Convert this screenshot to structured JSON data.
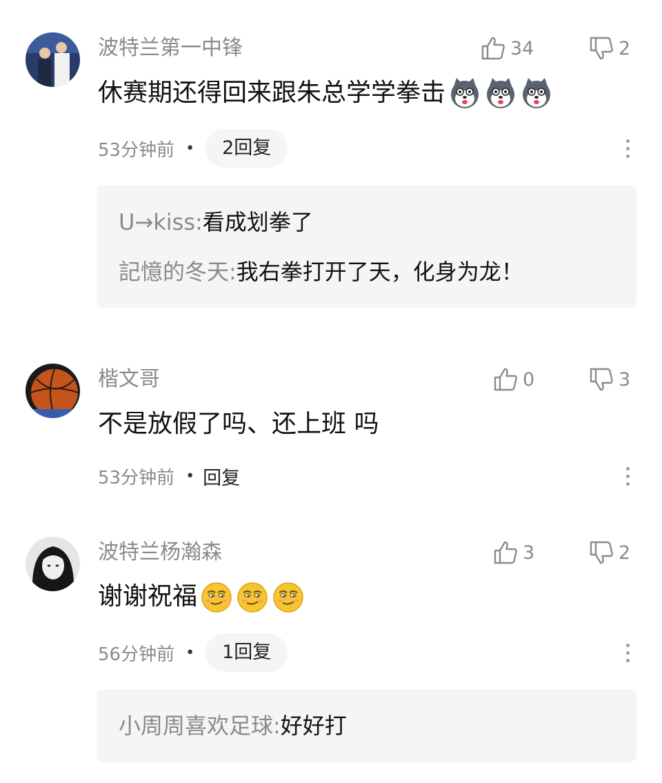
{
  "comments": [
    {
      "username": "波特兰第一中锋",
      "likes": "34",
      "dislikes": "2",
      "text": "休赛期还得回来跟朱总学学拳击",
      "emoji_icon": "husky-emoji",
      "emoji_count": 3,
      "time": "53分钟前",
      "reply_label": "2回复",
      "replies": [
        {
          "user": "U→kiss",
          "sep": ":",
          "text": "看成划拳了"
        },
        {
          "user": "記憶的冬天",
          "sep": ":",
          "text": "我右拳打开了天，化身为龙！"
        }
      ]
    },
    {
      "username": "楷文哥",
      "likes": "0",
      "dislikes": "3",
      "text": "不是放假了吗、还上班 吗",
      "time": "53分钟前",
      "reply_label": "回复",
      "replies": []
    },
    {
      "username": "波特兰杨瀚森",
      "likes": "3",
      "dislikes": "2",
      "text": "谢谢祝福",
      "emoji_icon": "smirk-emoji",
      "emoji_count": 3,
      "time": "56分钟前",
      "reply_label": "1回复",
      "replies": [
        {
          "user": "小周周喜欢足球",
          "sep": ":",
          "text": "好好打"
        }
      ]
    }
  ],
  "separator_dot": "•",
  "colors": {
    "secondary_text": "#8a8a8a",
    "primary_text": "#111111",
    "reply_bg": "#f5f5f7"
  }
}
